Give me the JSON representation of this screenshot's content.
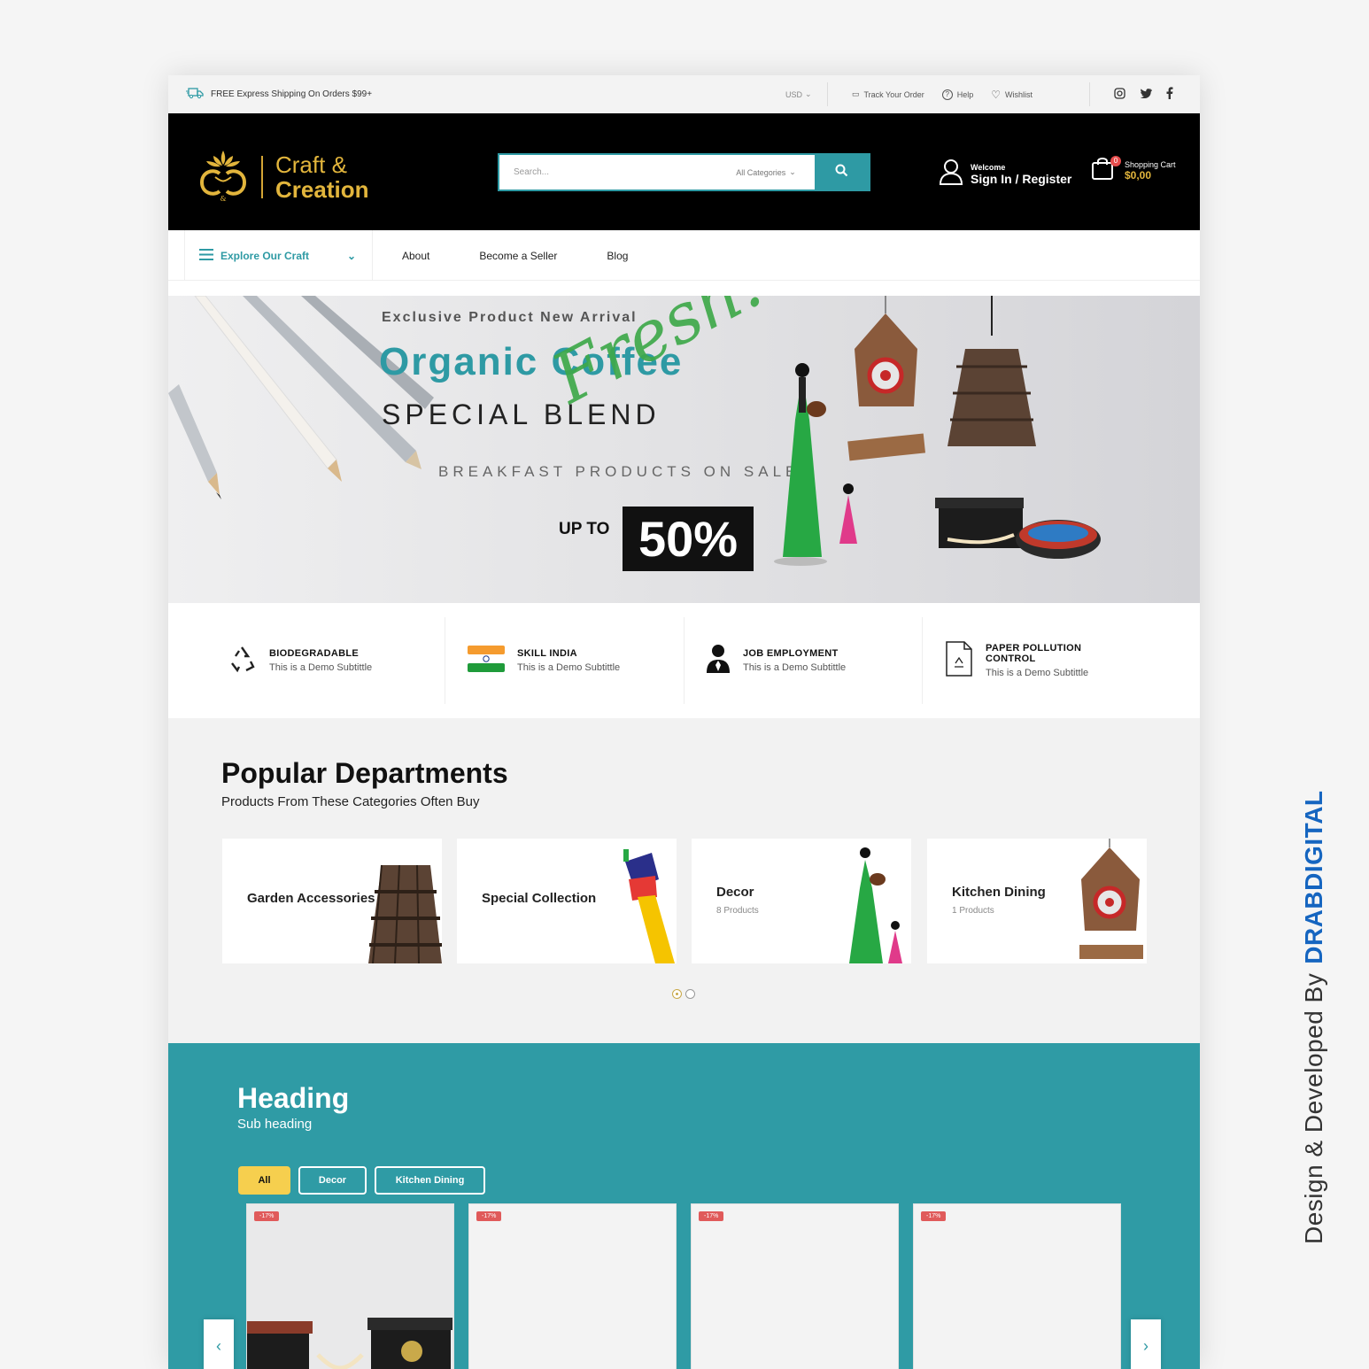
{
  "topbar": {
    "shipping": "FREE Express Shipping On Orders $99+",
    "currency": "USD",
    "links": [
      "Track Your Order",
      "Help",
      "Wishlist"
    ],
    "social": [
      "instagram-icon",
      "twitter-icon",
      "facebook-icon"
    ]
  },
  "header": {
    "logo_line1": "Craft &",
    "logo_line2": "Creation",
    "search_placeholder": "Search...",
    "search_category": "All Categories",
    "welcome": "Welcome",
    "signin": "Sign In / Register",
    "cart_label": "Shopping Cart",
    "cart_count": "0",
    "cart_total": "$0,00"
  },
  "nav": {
    "explore": "Explore Our Craft",
    "items": [
      "About",
      "Become a Seller",
      "Blog"
    ]
  },
  "hero": {
    "eyebrow": "Exclusive Product New Arrival",
    "title": "Organic Coffee",
    "subtitle": "SPECIAL BLEND",
    "script": "Fresh!",
    "sale": "BREAKFAST PRODUCTS ON SALE",
    "upto": "UP TO",
    "discount": "50%"
  },
  "features": [
    {
      "title": "BIODEGRADABLE",
      "subtitle": "This is a Demo Subtittle"
    },
    {
      "title": "SKILL INDIA",
      "subtitle": "This is a Demo Subtittle"
    },
    {
      "title": "JOB EMPLOYMENT",
      "subtitle": "This is a Demo Subtittle"
    },
    {
      "title": "PAPER POLLUTION CONTROL",
      "subtitle": "This is a Demo Subtittle"
    }
  ],
  "departments": {
    "heading": "Popular Departments",
    "subheading": "Products From These Categories Often Buy",
    "cards": [
      {
        "name": "Garden Accessories",
        "count": ""
      },
      {
        "name": "Special Collection",
        "count": ""
      },
      {
        "name": "Decor",
        "count": "8 Products"
      },
      {
        "name": "Kitchen Dining",
        "count": "1 Products"
      }
    ]
  },
  "products_section": {
    "heading": "Heading",
    "subheading": "Sub heading",
    "filters": [
      "All",
      "Decor",
      "Kitchen Dining"
    ],
    "badges": [
      "-17%",
      "-17%",
      "-17%",
      "-17%"
    ]
  },
  "credit": {
    "prefix": "Design & Developed By",
    "brand": "DRABDIGITAL"
  },
  "colors": {
    "accent": "#2e9aa4",
    "gold": "#e2b53c",
    "header_bg": "#000000",
    "filter_active": "#f6cf4e"
  }
}
